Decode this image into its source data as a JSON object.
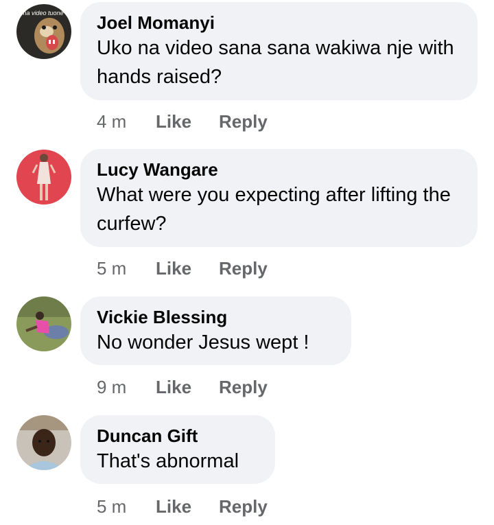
{
  "comments": [
    {
      "author": "Joel Momanyi",
      "text": "Uko na video sana sana wakiwa nje with hands raised?",
      "time": "4 m",
      "like_label": "Like",
      "reply_label": "Reply",
      "avatar_caption": "o na video tuone"
    },
    {
      "author": "Lucy Wangare",
      "text": "What were you expecting after lifting the curfew?",
      "time": "5 m",
      "like_label": "Like",
      "reply_label": "Reply"
    },
    {
      "author": "Vickie Blessing",
      "text": "No wonder Jesus wept !",
      "time": "9 m",
      "like_label": "Like",
      "reply_label": "Reply"
    },
    {
      "author": "Duncan Gift",
      "text": "That's abnormal",
      "time": "5 m",
      "like_label": "Like",
      "reply_label": "Reply"
    }
  ],
  "colors": {
    "bubble_bg": "#f0f2f5",
    "text": "#050505",
    "meta": "#65676b"
  }
}
